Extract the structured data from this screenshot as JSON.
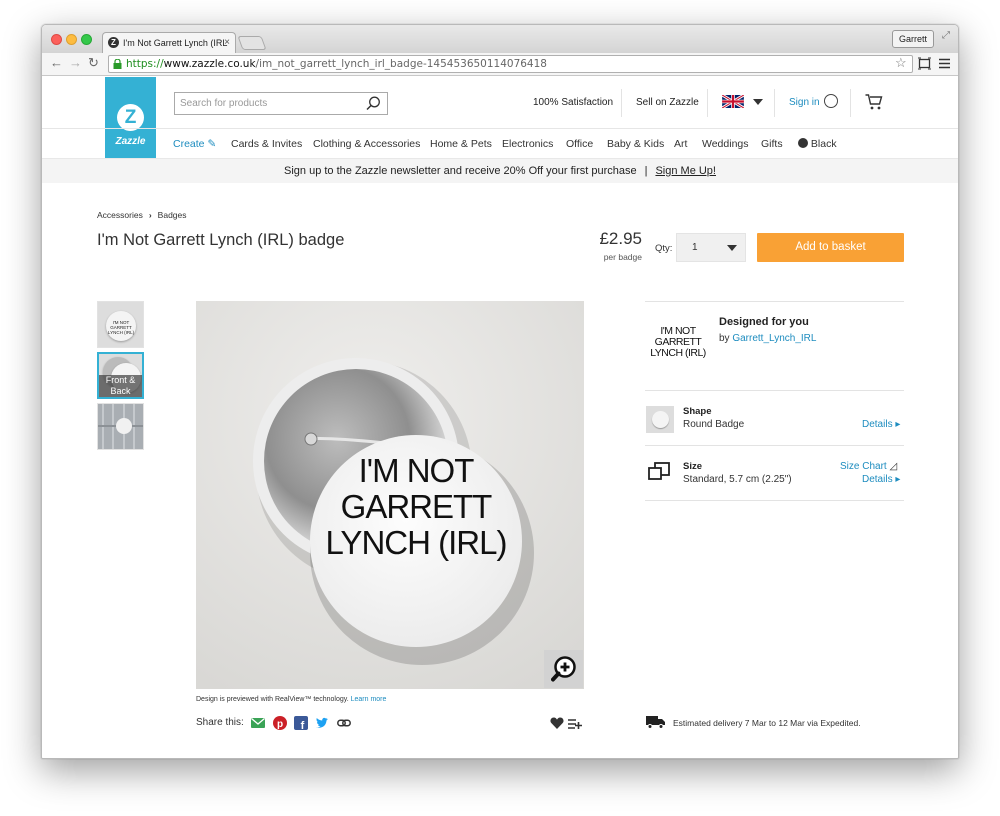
{
  "browser": {
    "tab_title": "I'm Not Garrett Lynch (IRL",
    "tab_favicon": "Z",
    "tab_close": "×",
    "profile_name": "Garrett",
    "url_scheme": "https://",
    "url_host": "www.zazzle.co.uk",
    "url_path": "/im_not_garrett_lynch_irl_badge-145453650114076418"
  },
  "header": {
    "logo_text": "Zazzle",
    "logo_mark": "Z",
    "search_placeholder": "Search for products",
    "satisfaction": "100% Satisfaction",
    "sell": "Sell on Zazzle",
    "signin": "Sign in"
  },
  "nav": {
    "create": "Create",
    "items": [
      "Cards & Invites",
      "Clothing & Accessories",
      "Home & Pets",
      "Electronics",
      "Office",
      "Baby & Kids",
      "Art",
      "Weddings",
      "Gifts",
      "Black"
    ]
  },
  "banner": {
    "text": "Sign up to the Zazzle newsletter and receive 20% Off your first purchase",
    "separator": "|",
    "cta": "Sign Me Up!"
  },
  "breadcrumb": [
    "Accessories",
    "Badges"
  ],
  "breadcrumb_sep": "›",
  "product": {
    "title": "I'm Not Garrett Lynch (IRL) badge",
    "price": "£2.95",
    "per_unit": "per badge",
    "qty_label": "Qty:",
    "qty_value": "1",
    "add_to_basket": "Add to basket",
    "badge_text": [
      "I'M NOT",
      "GARRETT",
      "LYNCH (IRL)"
    ],
    "thumb_label": "Front & Back",
    "preview_note": "Design is previewed with RealView™ technology.",
    "learn_more": "Learn more",
    "share_label": "Share this:"
  },
  "design": {
    "heading": "Designed for you",
    "by_prefix": "by",
    "author": "Garrett_Lynch_IRL",
    "thumb_text": [
      "I'M NOT",
      "GARRETT",
      "LYNCH (IRL)"
    ]
  },
  "options": [
    {
      "label": "Shape",
      "value": "Round Badge",
      "link": "Details ▸"
    },
    {
      "label": "Size",
      "value": "Standard, 5.7 cm (2.25\")",
      "link": "Details ▸",
      "extra_link": "Size Chart"
    }
  ],
  "delivery": "Estimated delivery 7 Mar to 12 Mar via Expedited.",
  "colors": {
    "brand_blue": "#34b1d4",
    "link_blue": "#1d8cbf",
    "cta_orange": "#f9a135",
    "email_green": "#3aa356",
    "pinterest_red": "#cb2027",
    "facebook_blue": "#3b5998",
    "twitter_blue": "#1da1f2"
  },
  "icons": [
    "search-icon",
    "chevron-down-icon",
    "user-icon",
    "cart-icon",
    "pencil-icon",
    "zoom-in-icon",
    "email-icon",
    "pinterest-icon",
    "facebook-icon",
    "twitter-icon",
    "link-icon",
    "heart-icon",
    "add-to-list-icon",
    "truck-icon",
    "size-icon",
    "size-chart-icon"
  ]
}
